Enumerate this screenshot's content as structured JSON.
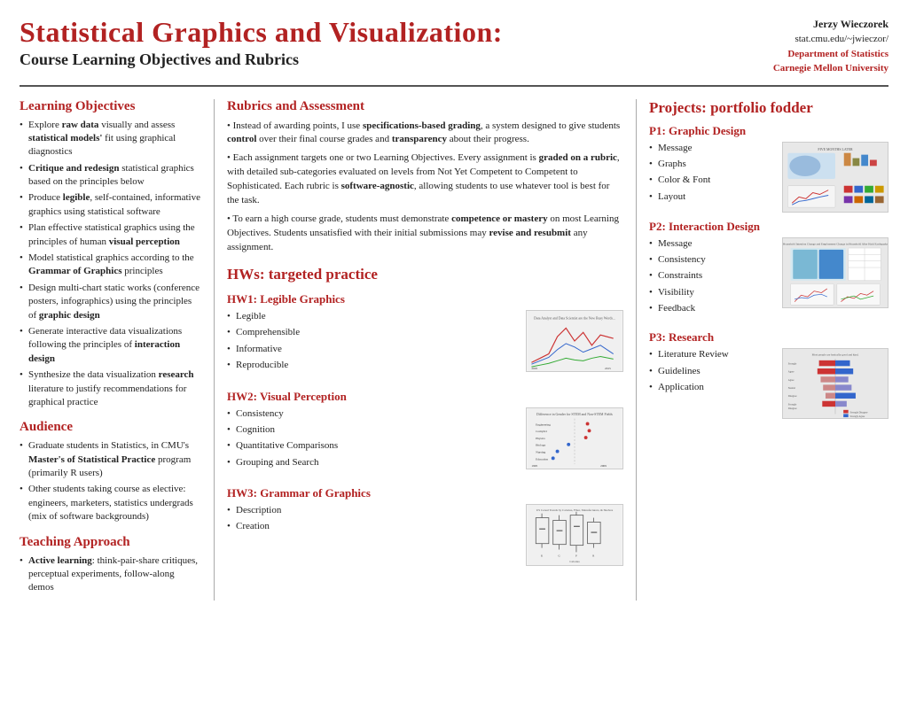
{
  "header": {
    "title": "Statistical Graphics and Visualization:",
    "subtitle": "Course Learning Objectives and Rubrics",
    "author_name": "Jerzy Wieczorek",
    "author_url": "stat.cmu.edu/~jwieczor/",
    "dept": "Department of Statistics",
    "university": "Carnegie Mellon University"
  },
  "left": {
    "learning_objectives_title": "Learning Objectives",
    "learning_objectives": [
      "Explore raw data visually and assess statistical models' fit using graphical diagnostics",
      "Critique and redesign statistical graphics based on the principles below",
      "Produce legible, self-contained, informative graphics using statistical software",
      "Plan effective statistical graphics using the principles of human visual perception",
      "Model statistical graphics according to the Grammar of Graphics principles",
      "Design multi-chart static works (conference posters, infographics) using the principles of graphic design",
      "Generate interactive data visualizations following the principles of interaction design",
      "Synthesize the data visualization research literature to justify recommendations for graphical practice"
    ],
    "audience_title": "Audience",
    "audience": [
      "Graduate students in Statistics, in CMU's Master's of Statistical Practice program (primarily R users)",
      "Other students taking course as elective: engineers, marketers, statistics undergrads (mix of software backgrounds)"
    ],
    "teaching_title": "Teaching Approach",
    "teaching": [
      "Active learning: think-pair-share critiques, perceptual experiments, follow-along demos"
    ]
  },
  "middle": {
    "rubrics_title": "Rubrics and Assessment",
    "rubrics_paras": [
      "• Instead of awarding points, I use specifications-based grading, a system designed to give students control over their final course grades and transparency about their progress.",
      "• Each assignment targets one or two Learning Objectives. Every assignment is graded on a rubric, with detailed sub-categories evaluated on levels from Not Yet Competent to Competent to Sophisticated. Each rubric is software-agnostic, allowing students to use whatever tool is best for the task.",
      "• To earn a high course grade, students must demonstrate competence or mastery on most Learning Objectives. Students unsatisfied with their initial submissions may revise and resubmit any assignment."
    ],
    "hw_section_title": "HWs: targeted practice",
    "hw1_title": "HW1: Legible Graphics",
    "hw1_items": [
      "Legible",
      "Comprehensible",
      "Informative",
      "Reproducible"
    ],
    "hw2_title": "HW2: Visual Perception",
    "hw2_items": [
      "Consistency",
      "Cognition",
      "Quantitative Comparisons",
      "Grouping and Search"
    ],
    "hw3_title": "HW3: Grammar of Graphics",
    "hw3_items": [
      "Description",
      "Creation"
    ]
  },
  "right": {
    "projects_title": "Projects: portfolio fodder",
    "p1_title": "P1: Graphic Design",
    "p1_items": [
      "Message",
      "Graphs",
      "Color & Font",
      "Layout"
    ],
    "p2_title": "P2: Interaction Design",
    "p2_items": [
      "Message",
      "Consistency",
      "Constraints",
      "Visibility",
      "Feedback"
    ],
    "p3_title": "P3: Research",
    "p3_items": [
      "Literature Review",
      "Guidelines",
      "Application"
    ]
  }
}
